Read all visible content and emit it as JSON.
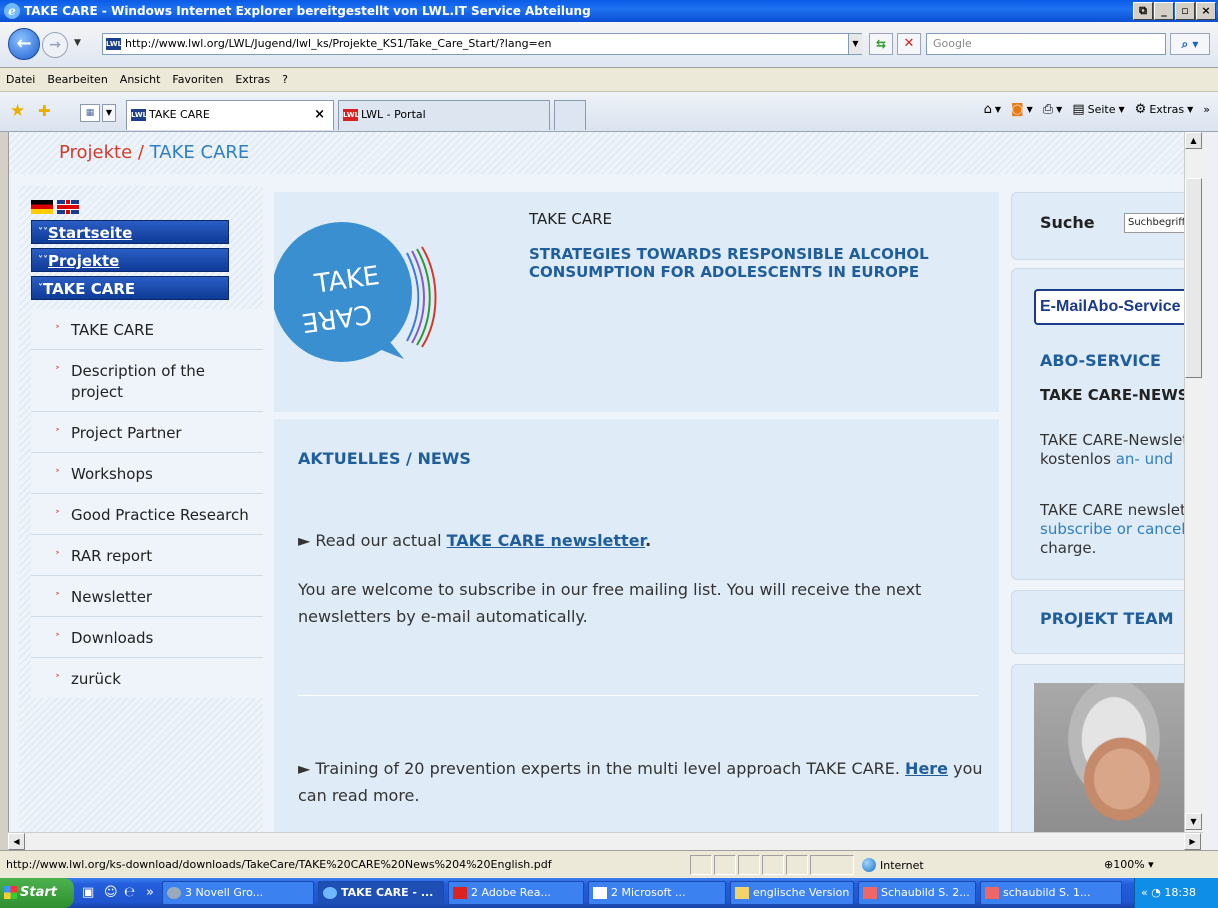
{
  "window": {
    "title": "TAKE CARE - Windows Internet Explorer bereitgestellt von LWL.IT Service Abteilung"
  },
  "address": {
    "favicon_text": "LWL",
    "url": "http://www.lwl.org/LWL/Jugend/lwl_ks/Projekte_KS1/Take_Care_Start/?lang=en",
    "search_placeholder": "Google"
  },
  "menu": [
    "Datei",
    "Bearbeiten",
    "Ansicht",
    "Favoriten",
    "Extras",
    "?"
  ],
  "tabs": {
    "active": "TAKE CARE",
    "close": "×",
    "inactive": "LWL - Portal",
    "favicon_text": "LWL"
  },
  "commands": {
    "page": "Seite",
    "extras": "Extras",
    "more": "»"
  },
  "breadcrumb": {
    "parent": "Projekte",
    "separator": " / ",
    "current": "TAKE CARE"
  },
  "sidebar": {
    "nav": [
      {
        "label": "Startseite"
      },
      {
        "label": "Projekte"
      },
      {
        "label": "TAKE CARE"
      }
    ],
    "items": [
      {
        "label": "TAKE CARE"
      },
      {
        "label": "Description of the project"
      },
      {
        "label": "Project Partner"
      },
      {
        "label": "Workshops"
      },
      {
        "label": "Good Practice Research"
      },
      {
        "label": "RAR report"
      },
      {
        "label": "Newsletter"
      },
      {
        "label": "Downloads"
      },
      {
        "label": "zurück"
      }
    ]
  },
  "main": {
    "logo_text_top": "TAKE",
    "logo_text_bottom": "CARE",
    "title": "TAKE CARE",
    "subtitle": "STRATEGIES TOWARDS RESPONSIBLE ALCOHOL CONSUMPTION FOR ADOLESCENTS IN EUROPE",
    "news_heading": "AKTUELLES / NEWS",
    "news1_prefix": "► Read our actual ",
    "news1_link": "TAKE CARE newsletter",
    "news1_suffix": ".",
    "news2": "You are welcome to subscribe in our free mailing list. You will receive the next newsletters by e-mail automatically.",
    "news3_prefix": "► Training of 20 prevention experts in the multi level approach TAKE CARE. ",
    "news3_link": "Here",
    "news3_suffix": " you can read more."
  },
  "right": {
    "search_label": "Suche",
    "search_value": "Suchbegriff",
    "emailabo": "E-MailAbo-Service",
    "abo_heading": "ABO-SERVICE",
    "abo_news": "TAKE CARE-NEWS",
    "abo_p1_a": "TAKE CARE-Newsletter",
    "abo_p1_b": "kostenlos ",
    "abo_p1_link": "an- und",
    "abo_p2_a": "TAKE CARE newsletter",
    "abo_p2_link": "subscribe or cancel",
    "abo_p2_c": "charge.",
    "project_team": "PROJEKT TEAM"
  },
  "status": {
    "text": "http://www.lwl.org/ks-download/downloads/TakeCare/TAKE%20CARE%20News%204%20English.pdf",
    "zone": "Internet",
    "zoom": "100%"
  },
  "taskbar": {
    "start": "Start",
    "items": [
      {
        "label": "3 Novell Gro..."
      },
      {
        "label": "TAKE CARE - ..."
      },
      {
        "label": "2 Adobe Rea..."
      },
      {
        "label": "2 Microsoft ..."
      },
      {
        "label": "englische Version"
      },
      {
        "label": "Schaubild S. 2..."
      },
      {
        "label": "schaubild S. 1..."
      }
    ],
    "clock": "18:38"
  },
  "colors": {
    "title_bar": "#0a5be6",
    "nav_button": "#1f4fb0",
    "heading_blue": "#1f5e9a",
    "breadcrumb_red": "#d23a2a",
    "link_blue": "#2e7fc1"
  }
}
